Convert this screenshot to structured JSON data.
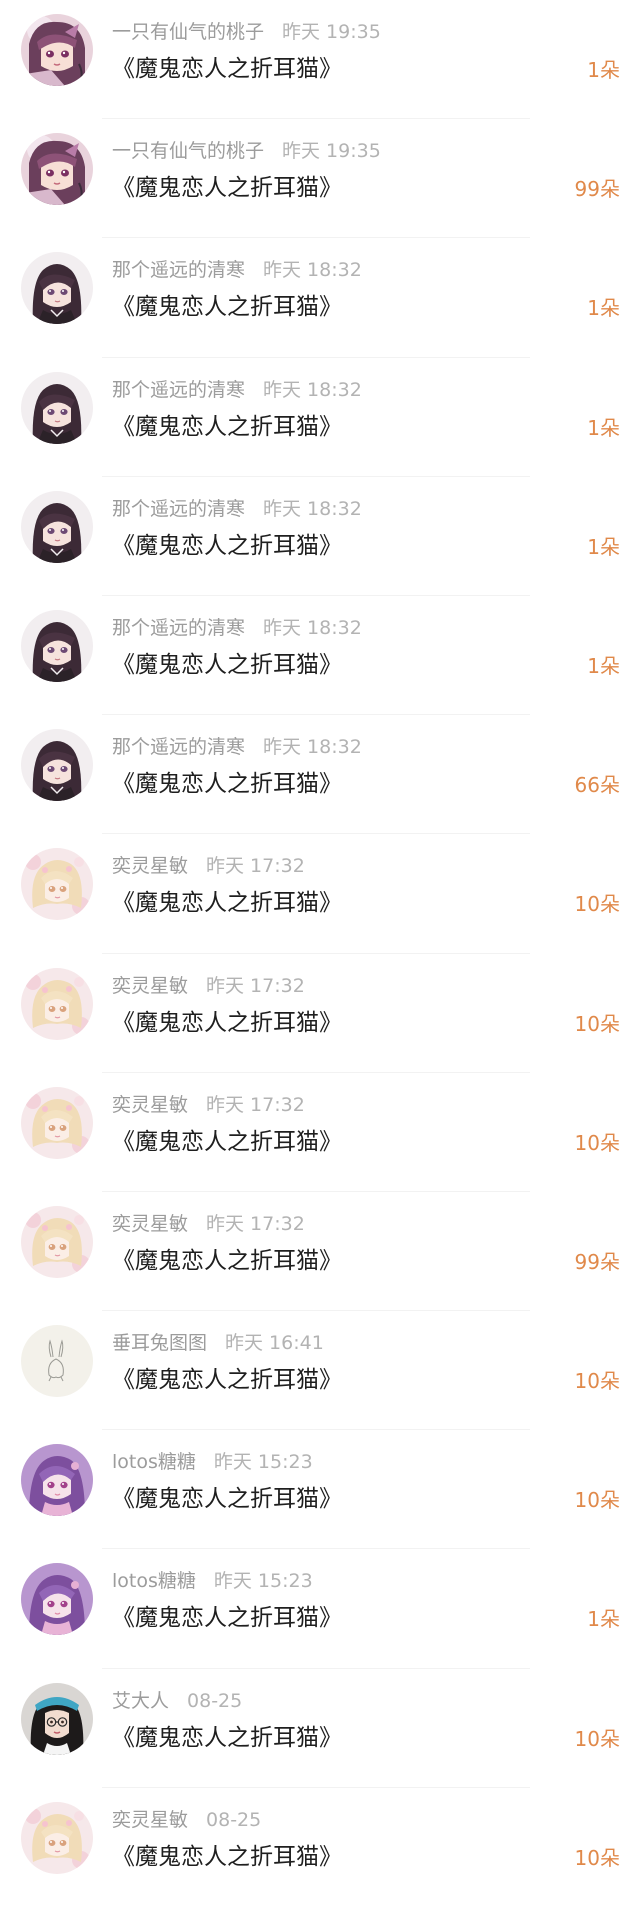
{
  "colors": {
    "count": "#e0894a",
    "meta": "#a6a6a6",
    "title": "#1f1f1f"
  },
  "records": [
    {
      "user": "一只有仙气的桃子",
      "time": "昨天 19:35",
      "gift": "《魔鬼恋人之折耳猫》",
      "count": "1朵",
      "avatar": "peach"
    },
    {
      "user": "一只有仙气的桃子",
      "time": "昨天 19:35",
      "gift": "《魔鬼恋人之折耳猫》",
      "count": "99朵",
      "avatar": "peach"
    },
    {
      "user": "那个遥远的清寒",
      "time": "昨天 18:32",
      "gift": "《魔鬼恋人之折耳猫》",
      "count": "1朵",
      "avatar": "dark-hair-girl"
    },
    {
      "user": "那个遥远的清寒",
      "time": "昨天 18:32",
      "gift": "《魔鬼恋人之折耳猫》",
      "count": "1朵",
      "avatar": "dark-hair-girl"
    },
    {
      "user": "那个遥远的清寒",
      "time": "昨天 18:32",
      "gift": "《魔鬼恋人之折耳猫》",
      "count": "1朵",
      "avatar": "dark-hair-girl"
    },
    {
      "user": "那个遥远的清寒",
      "time": "昨天 18:32",
      "gift": "《魔鬼恋人之折耳猫》",
      "count": "1朵",
      "avatar": "dark-hair-girl"
    },
    {
      "user": "那个遥远的清寒",
      "time": "昨天 18:32",
      "gift": "《魔鬼恋人之折耳猫》",
      "count": "66朵",
      "avatar": "dark-hair-girl"
    },
    {
      "user": "奕灵星敏",
      "time": "昨天 17:32",
      "gift": "《魔鬼恋人之折耳猫》",
      "count": "10朵",
      "avatar": "blonde-girl"
    },
    {
      "user": "奕灵星敏",
      "time": "昨天 17:32",
      "gift": "《魔鬼恋人之折耳猫》",
      "count": "10朵",
      "avatar": "blonde-girl"
    },
    {
      "user": "奕灵星敏",
      "time": "昨天 17:32",
      "gift": "《魔鬼恋人之折耳猫》",
      "count": "10朵",
      "avatar": "blonde-girl"
    },
    {
      "user": "奕灵星敏",
      "time": "昨天 17:32",
      "gift": "《魔鬼恋人之折耳猫》",
      "count": "99朵",
      "avatar": "blonde-girl"
    },
    {
      "user": "垂耳兔图图",
      "time": "昨天 16:41",
      "gift": "《魔鬼恋人之折耳猫》",
      "count": "10朵",
      "avatar": "bunny-sketch"
    },
    {
      "user": "lotos糖糖",
      "time": "昨天 15:23",
      "gift": "《魔鬼恋人之折耳猫》",
      "count": "10朵",
      "avatar": "purple-girl"
    },
    {
      "user": "lotos糖糖",
      "time": "昨天 15:23",
      "gift": "《魔鬼恋人之折耳猫》",
      "count": "1朵",
      "avatar": "purple-girl"
    },
    {
      "user": "艾大人",
      "time": "08-25",
      "gift": "《魔鬼恋人之折耳猫》",
      "count": "10朵",
      "avatar": "photo-girl"
    },
    {
      "user": "奕灵星敏",
      "time": "08-25",
      "gift": "《魔鬼恋人之折耳猫》",
      "count": "10朵",
      "avatar": "blonde-girl"
    }
  ]
}
